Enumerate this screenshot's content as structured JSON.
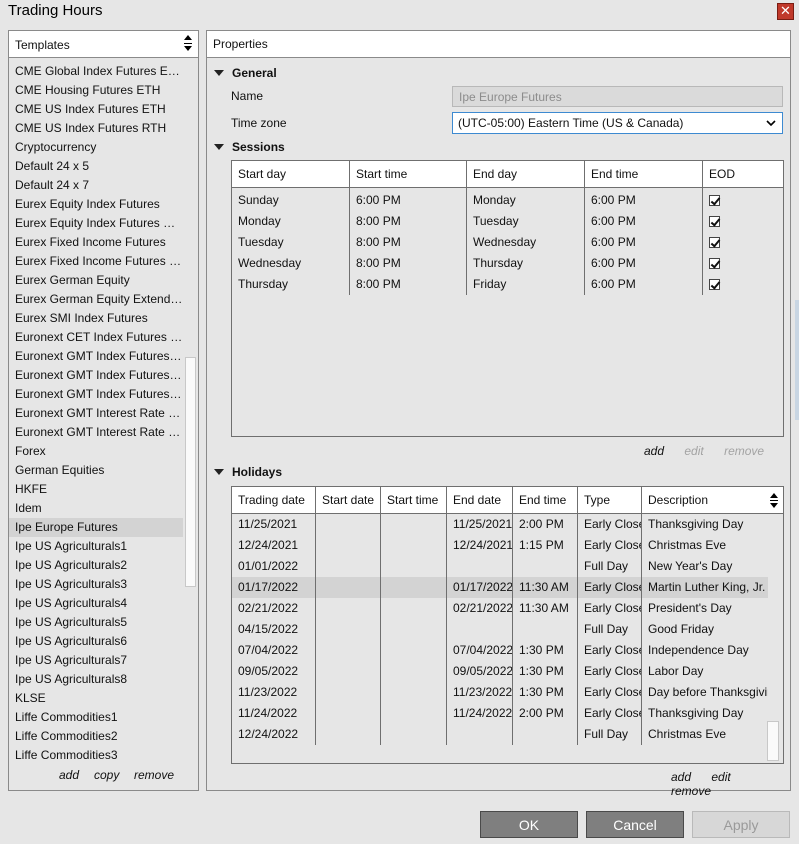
{
  "window": {
    "title": "Trading Hours",
    "close_icon": "close-icon"
  },
  "templates": {
    "header": "Templates",
    "items": [
      "CME Global Index Futures ETH",
      "CME Housing Futures ETH",
      "CME US Index Futures ETH",
      "CME US Index Futures RTH",
      "Cryptocurrency",
      "Default 24 x 5",
      "Default 24 x 7",
      "Eurex Equity Index Futures",
      "Eurex Equity Index Futures ETH",
      "Eurex Fixed Income Futures",
      "Eurex Fixed Income Futures ETH",
      "Eurex German Equity",
      "Eurex German Equity Extended",
      "Eurex SMI Index Futures",
      "Euronext CET Index Futures ETH",
      "Euronext GMT Index Futures ETH",
      "Euronext GMT Index Futures RTH",
      "Euronext GMT Index Futures SP",
      "Euronext GMT Interest Rate ETH",
      "Euronext GMT Interest Rate RTH",
      "Forex",
      "German Equities",
      "HKFE",
      "Idem",
      "Ipe Europe Futures",
      "Ipe US Agriculturals1",
      "Ipe US Agriculturals2",
      "Ipe US Agriculturals3",
      "Ipe US Agriculturals4",
      "Ipe US Agriculturals5",
      "Ipe US Agriculturals6",
      "Ipe US Agriculturals7",
      "Ipe US Agriculturals8",
      "KLSE",
      "Liffe Commodities1",
      "Liffe Commodities2",
      "Liffe Commodities3"
    ],
    "selected_index": 24,
    "actions": {
      "add": "add",
      "copy": "copy",
      "remove": "remove"
    }
  },
  "properties": {
    "header": "Properties",
    "general": {
      "title": "General",
      "name_label": "Name",
      "name_value": "Ipe Europe Futures",
      "timezone_label": "Time zone",
      "timezone_value": "(UTC-05:00) Eastern Time (US & Canada)"
    },
    "sessions": {
      "title": "Sessions",
      "columns": [
        "Start day",
        "Start time",
        "End day",
        "End time",
        "EOD"
      ],
      "rows": [
        {
          "start_day": "Sunday",
          "start_time": "6:00 PM",
          "end_day": "Monday",
          "end_time": "6:00 PM",
          "eod": true
        },
        {
          "start_day": "Monday",
          "start_time": "8:00 PM",
          "end_day": "Tuesday",
          "end_time": "6:00 PM",
          "eod": true
        },
        {
          "start_day": "Tuesday",
          "start_time": "8:00 PM",
          "end_day": "Wednesday",
          "end_time": "6:00 PM",
          "eod": true
        },
        {
          "start_day": "Wednesday",
          "start_time": "8:00 PM",
          "end_day": "Thursday",
          "end_time": "6:00 PM",
          "eod": true
        },
        {
          "start_day": "Thursday",
          "start_time": "8:00 PM",
          "end_day": "Friday",
          "end_time": "6:00 PM",
          "eod": true
        }
      ],
      "actions": {
        "add": "add",
        "edit": "edit",
        "remove": "remove"
      }
    },
    "holidays": {
      "title": "Holidays",
      "columns": [
        "Trading date",
        "Start date",
        "Start time",
        "End date",
        "End time",
        "Type",
        "Description"
      ],
      "rows": [
        {
          "trading_date": "11/25/2021",
          "start_date": "",
          "start_time": "",
          "end_date": "11/25/2021",
          "end_time": "2:00 PM",
          "type": "Early Close",
          "description": "Thanksgiving Day"
        },
        {
          "trading_date": "12/24/2021",
          "start_date": "",
          "start_time": "",
          "end_date": "12/24/2021",
          "end_time": "1:15 PM",
          "type": "Early Close",
          "description": "Christmas Eve"
        },
        {
          "trading_date": "01/01/2022",
          "start_date": "",
          "start_time": "",
          "end_date": "",
          "end_time": "",
          "type": "Full Day",
          "description": "New Year's Day"
        },
        {
          "trading_date": "01/17/2022",
          "start_date": "",
          "start_time": "",
          "end_date": "01/17/2022",
          "end_time": "11:30 AM",
          "type": "Early Close",
          "description": "Martin Luther King, Jr. Day"
        },
        {
          "trading_date": "02/21/2022",
          "start_date": "",
          "start_time": "",
          "end_date": "02/21/2022",
          "end_time": "11:30 AM",
          "type": "Early Close",
          "description": "President's Day"
        },
        {
          "trading_date": "04/15/2022",
          "start_date": "",
          "start_time": "",
          "end_date": "",
          "end_time": "",
          "type": "Full Day",
          "description": "Good Friday"
        },
        {
          "trading_date": "07/04/2022",
          "start_date": "",
          "start_time": "",
          "end_date": "07/04/2022",
          "end_time": "1:30 PM",
          "type": "Early Close",
          "description": "Independence Day"
        },
        {
          "trading_date": "09/05/2022",
          "start_date": "",
          "start_time": "",
          "end_date": "09/05/2022",
          "end_time": "1:30 PM",
          "type": "Early Close",
          "description": "Labor Day"
        },
        {
          "trading_date": "11/23/2022",
          "start_date": "",
          "start_time": "",
          "end_date": "11/23/2022",
          "end_time": "1:30 PM",
          "type": "Early Close",
          "description": "Day before Thanksgiving"
        },
        {
          "trading_date": "11/24/2022",
          "start_date": "",
          "start_time": "",
          "end_date": "11/24/2022",
          "end_time": "2:00 PM",
          "type": "Early Close",
          "description": "Thanksgiving Day"
        },
        {
          "trading_date": "12/24/2022",
          "start_date": "",
          "start_time": "",
          "end_date": "",
          "end_time": "",
          "type": "Full Day",
          "description": "Christmas Eve"
        }
      ],
      "selected_index": 3,
      "actions": {
        "add": "add",
        "edit": "edit",
        "remove": "remove"
      }
    }
  },
  "buttons": {
    "ok": "OK",
    "cancel": "Cancel",
    "apply": "Apply"
  }
}
